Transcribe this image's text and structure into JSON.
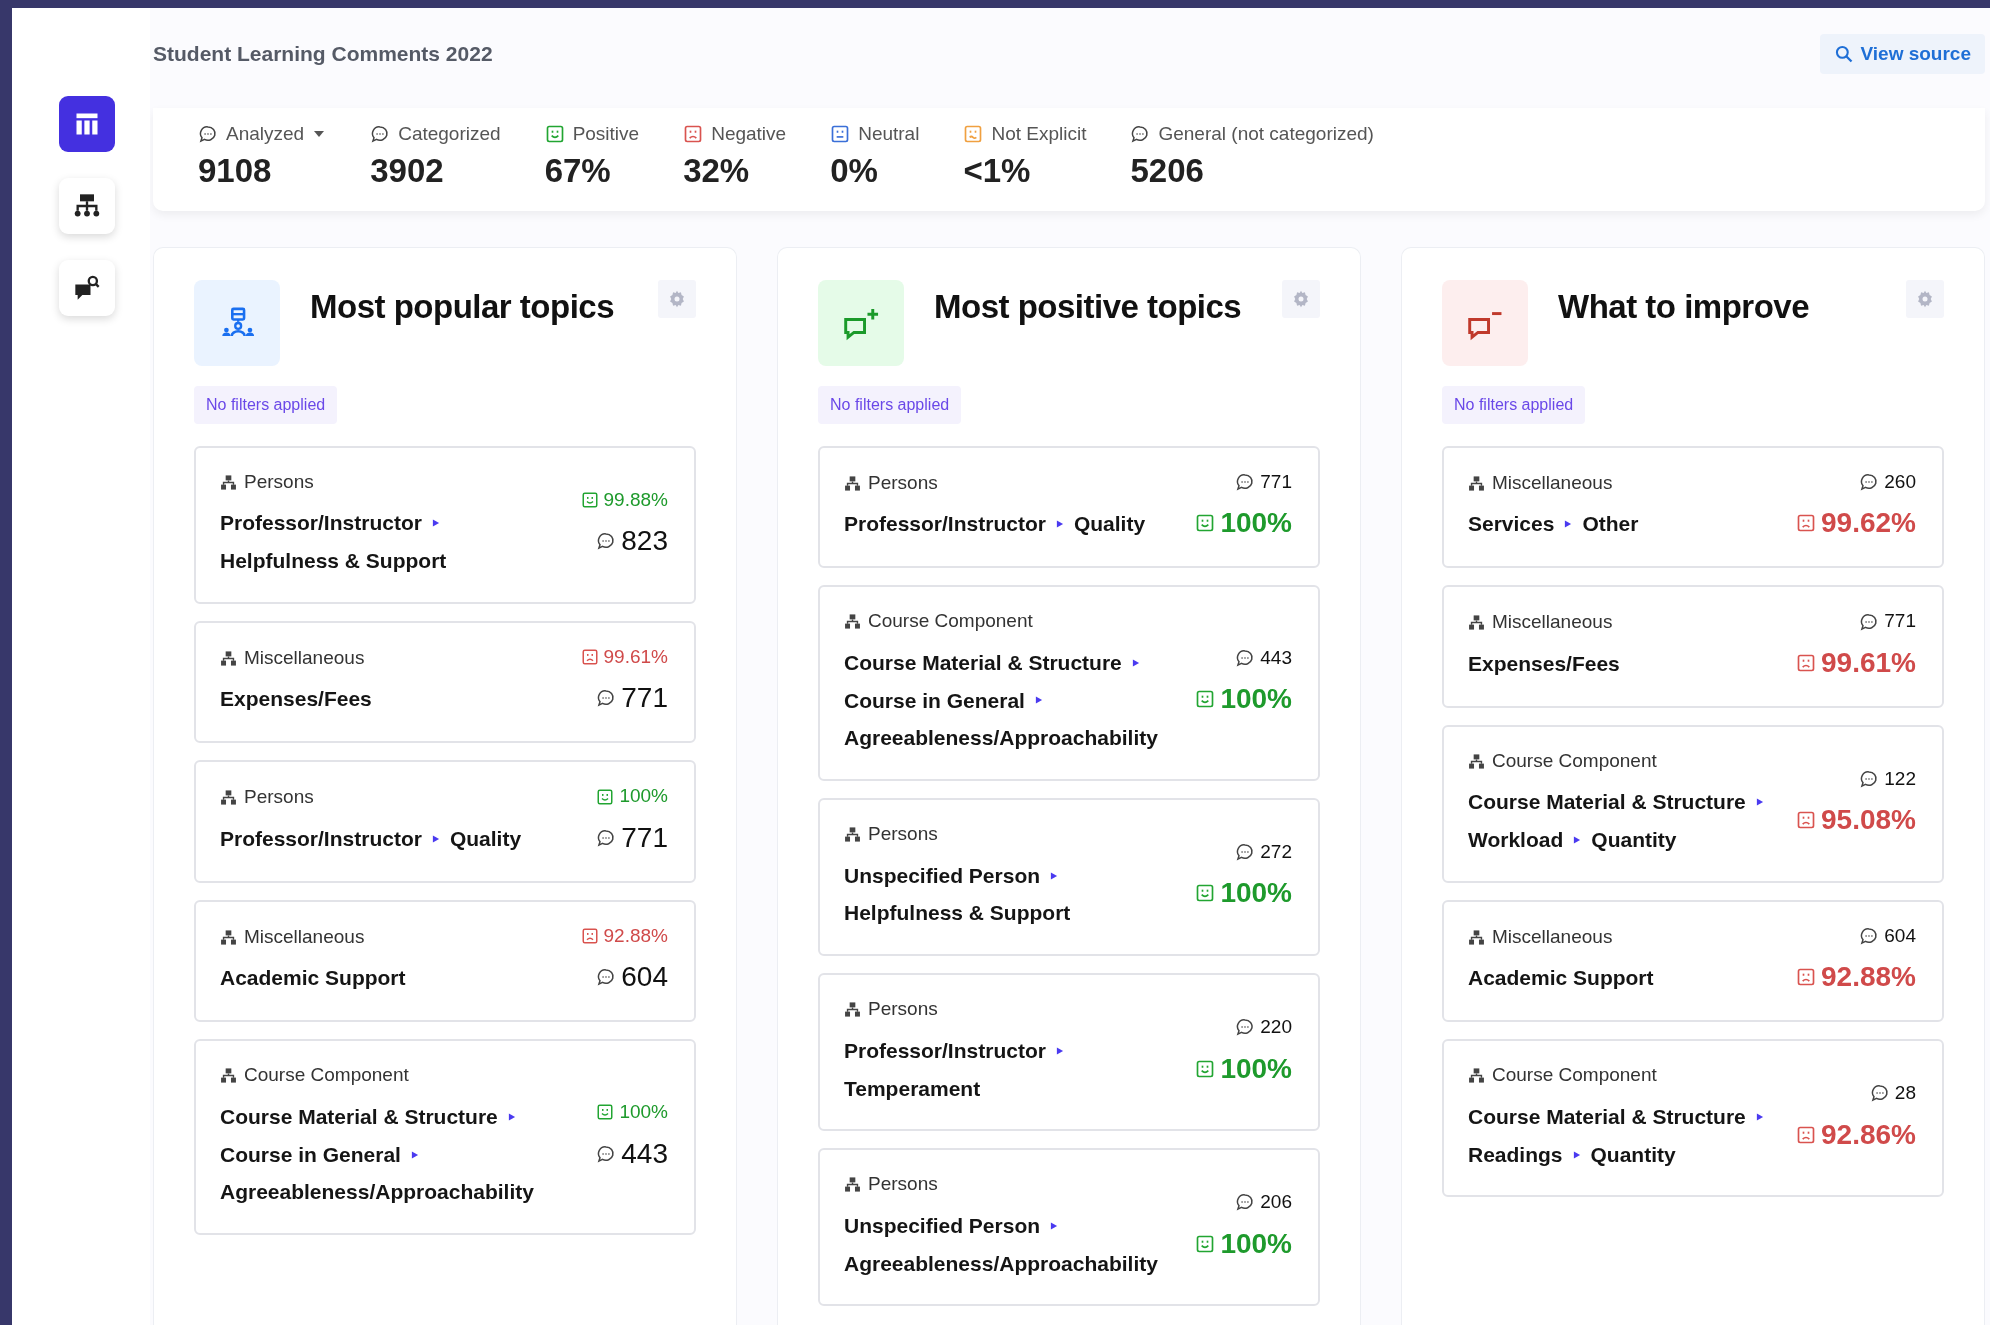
{
  "page": {
    "title": "Student Learning Comments 2022",
    "view_source": "View source"
  },
  "sidebar": {
    "items": [
      {
        "kind": "table",
        "selected": true
      },
      {
        "kind": "hierarchy",
        "selected": false
      },
      {
        "kind": "comment-search",
        "selected": false
      }
    ]
  },
  "stats": [
    {
      "kind": "comment",
      "label": "Analyzed",
      "value": "9108",
      "dropdown": true
    },
    {
      "kind": "comment",
      "label": "Categorized",
      "value": "3902",
      "dropdown": false
    },
    {
      "kind": "positive",
      "label": "Positive",
      "value": "67%",
      "dropdown": false
    },
    {
      "kind": "negative",
      "label": "Negative",
      "value": "32%",
      "dropdown": false
    },
    {
      "kind": "neutral",
      "label": "Neutral",
      "value": "0%",
      "dropdown": false
    },
    {
      "kind": "not_explicit",
      "label": "Not Explicit",
      "value": "<1%",
      "dropdown": false
    },
    {
      "kind": "comment",
      "label": "General (not categorized)",
      "value": "5206",
      "dropdown": false
    }
  ],
  "panels": [
    {
      "kind": "popular",
      "title": "Most popular topics",
      "filter": "No filters applied",
      "items": [
        {
          "category": "Persons",
          "lines": [
            [
              "Professor/Instructor"
            ],
            [
              "Helpfulness & Support"
            ]
          ],
          "kind": "positive",
          "percent": "99.88%",
          "count": "823"
        },
        {
          "category": "Miscellaneous",
          "lines": [
            [
              "Expenses/Fees"
            ]
          ],
          "kind": "negative",
          "percent": "99.61%",
          "count": "771"
        },
        {
          "category": "Persons",
          "lines": [
            [
              "Professor/Instructor",
              "Quality"
            ]
          ],
          "kind": "positive",
          "percent": "100%",
          "count": "771"
        },
        {
          "category": "Miscellaneous",
          "lines": [
            [
              "Academic Support"
            ]
          ],
          "kind": "negative",
          "percent": "92.88%",
          "count": "604"
        },
        {
          "category": "Course Component",
          "lines": [
            [
              "Course Material & Structure"
            ],
            [
              "Course in General"
            ],
            [
              "Agreeableness/Approachability"
            ]
          ],
          "kind": "positive",
          "percent": "100%",
          "count": "443"
        }
      ]
    },
    {
      "kind": "positive",
      "title": "Most positive topics",
      "filter": "No filters applied",
      "items": [
        {
          "category": "Persons",
          "lines": [
            [
              "Professor/Instructor",
              "Quality"
            ]
          ],
          "kind": "positive",
          "percent": "100%",
          "count": "771"
        },
        {
          "category": "Course Component",
          "lines": [
            [
              "Course Material & Structure"
            ],
            [
              "Course in General"
            ],
            [
              "Agreeableness/Approachability"
            ]
          ],
          "kind": "positive",
          "percent": "100%",
          "count": "443"
        },
        {
          "category": "Persons",
          "lines": [
            [
              "Unspecified Person"
            ],
            [
              "Helpfulness & Support"
            ]
          ],
          "kind": "positive",
          "percent": "100%",
          "count": "272"
        },
        {
          "category": "Persons",
          "lines": [
            [
              "Professor/Instructor"
            ],
            [
              "Temperament"
            ]
          ],
          "kind": "positive",
          "percent": "100%",
          "count": "220"
        },
        {
          "category": "Persons",
          "lines": [
            [
              "Unspecified Person"
            ],
            [
              "Agreeableness/Approachability"
            ]
          ],
          "kind": "positive",
          "percent": "100%",
          "count": "206"
        }
      ]
    },
    {
      "kind": "improve",
      "title": "What to improve",
      "filter": "No filters applied",
      "items": [
        {
          "category": "Miscellaneous",
          "lines": [
            [
              "Services",
              "Other"
            ]
          ],
          "kind": "negative",
          "percent": "99.62%",
          "count": "260"
        },
        {
          "category": "Miscellaneous",
          "lines": [
            [
              "Expenses/Fees"
            ]
          ],
          "kind": "negative",
          "percent": "99.61%",
          "count": "771"
        },
        {
          "category": "Course Component",
          "lines": [
            [
              "Course Material & Structure"
            ],
            [
              "Workload",
              "Quantity"
            ]
          ],
          "kind": "negative",
          "percent": "95.08%",
          "count": "122"
        },
        {
          "category": "Miscellaneous",
          "lines": [
            [
              "Academic Support"
            ]
          ],
          "kind": "negative",
          "percent": "92.88%",
          "count": "604"
        },
        {
          "category": "Course Component",
          "lines": [
            [
              "Course Material & Structure"
            ],
            [
              "Readings",
              "Quantity"
            ]
          ],
          "kind": "negative",
          "percent": "92.86%",
          "count": "28"
        }
      ]
    }
  ]
}
